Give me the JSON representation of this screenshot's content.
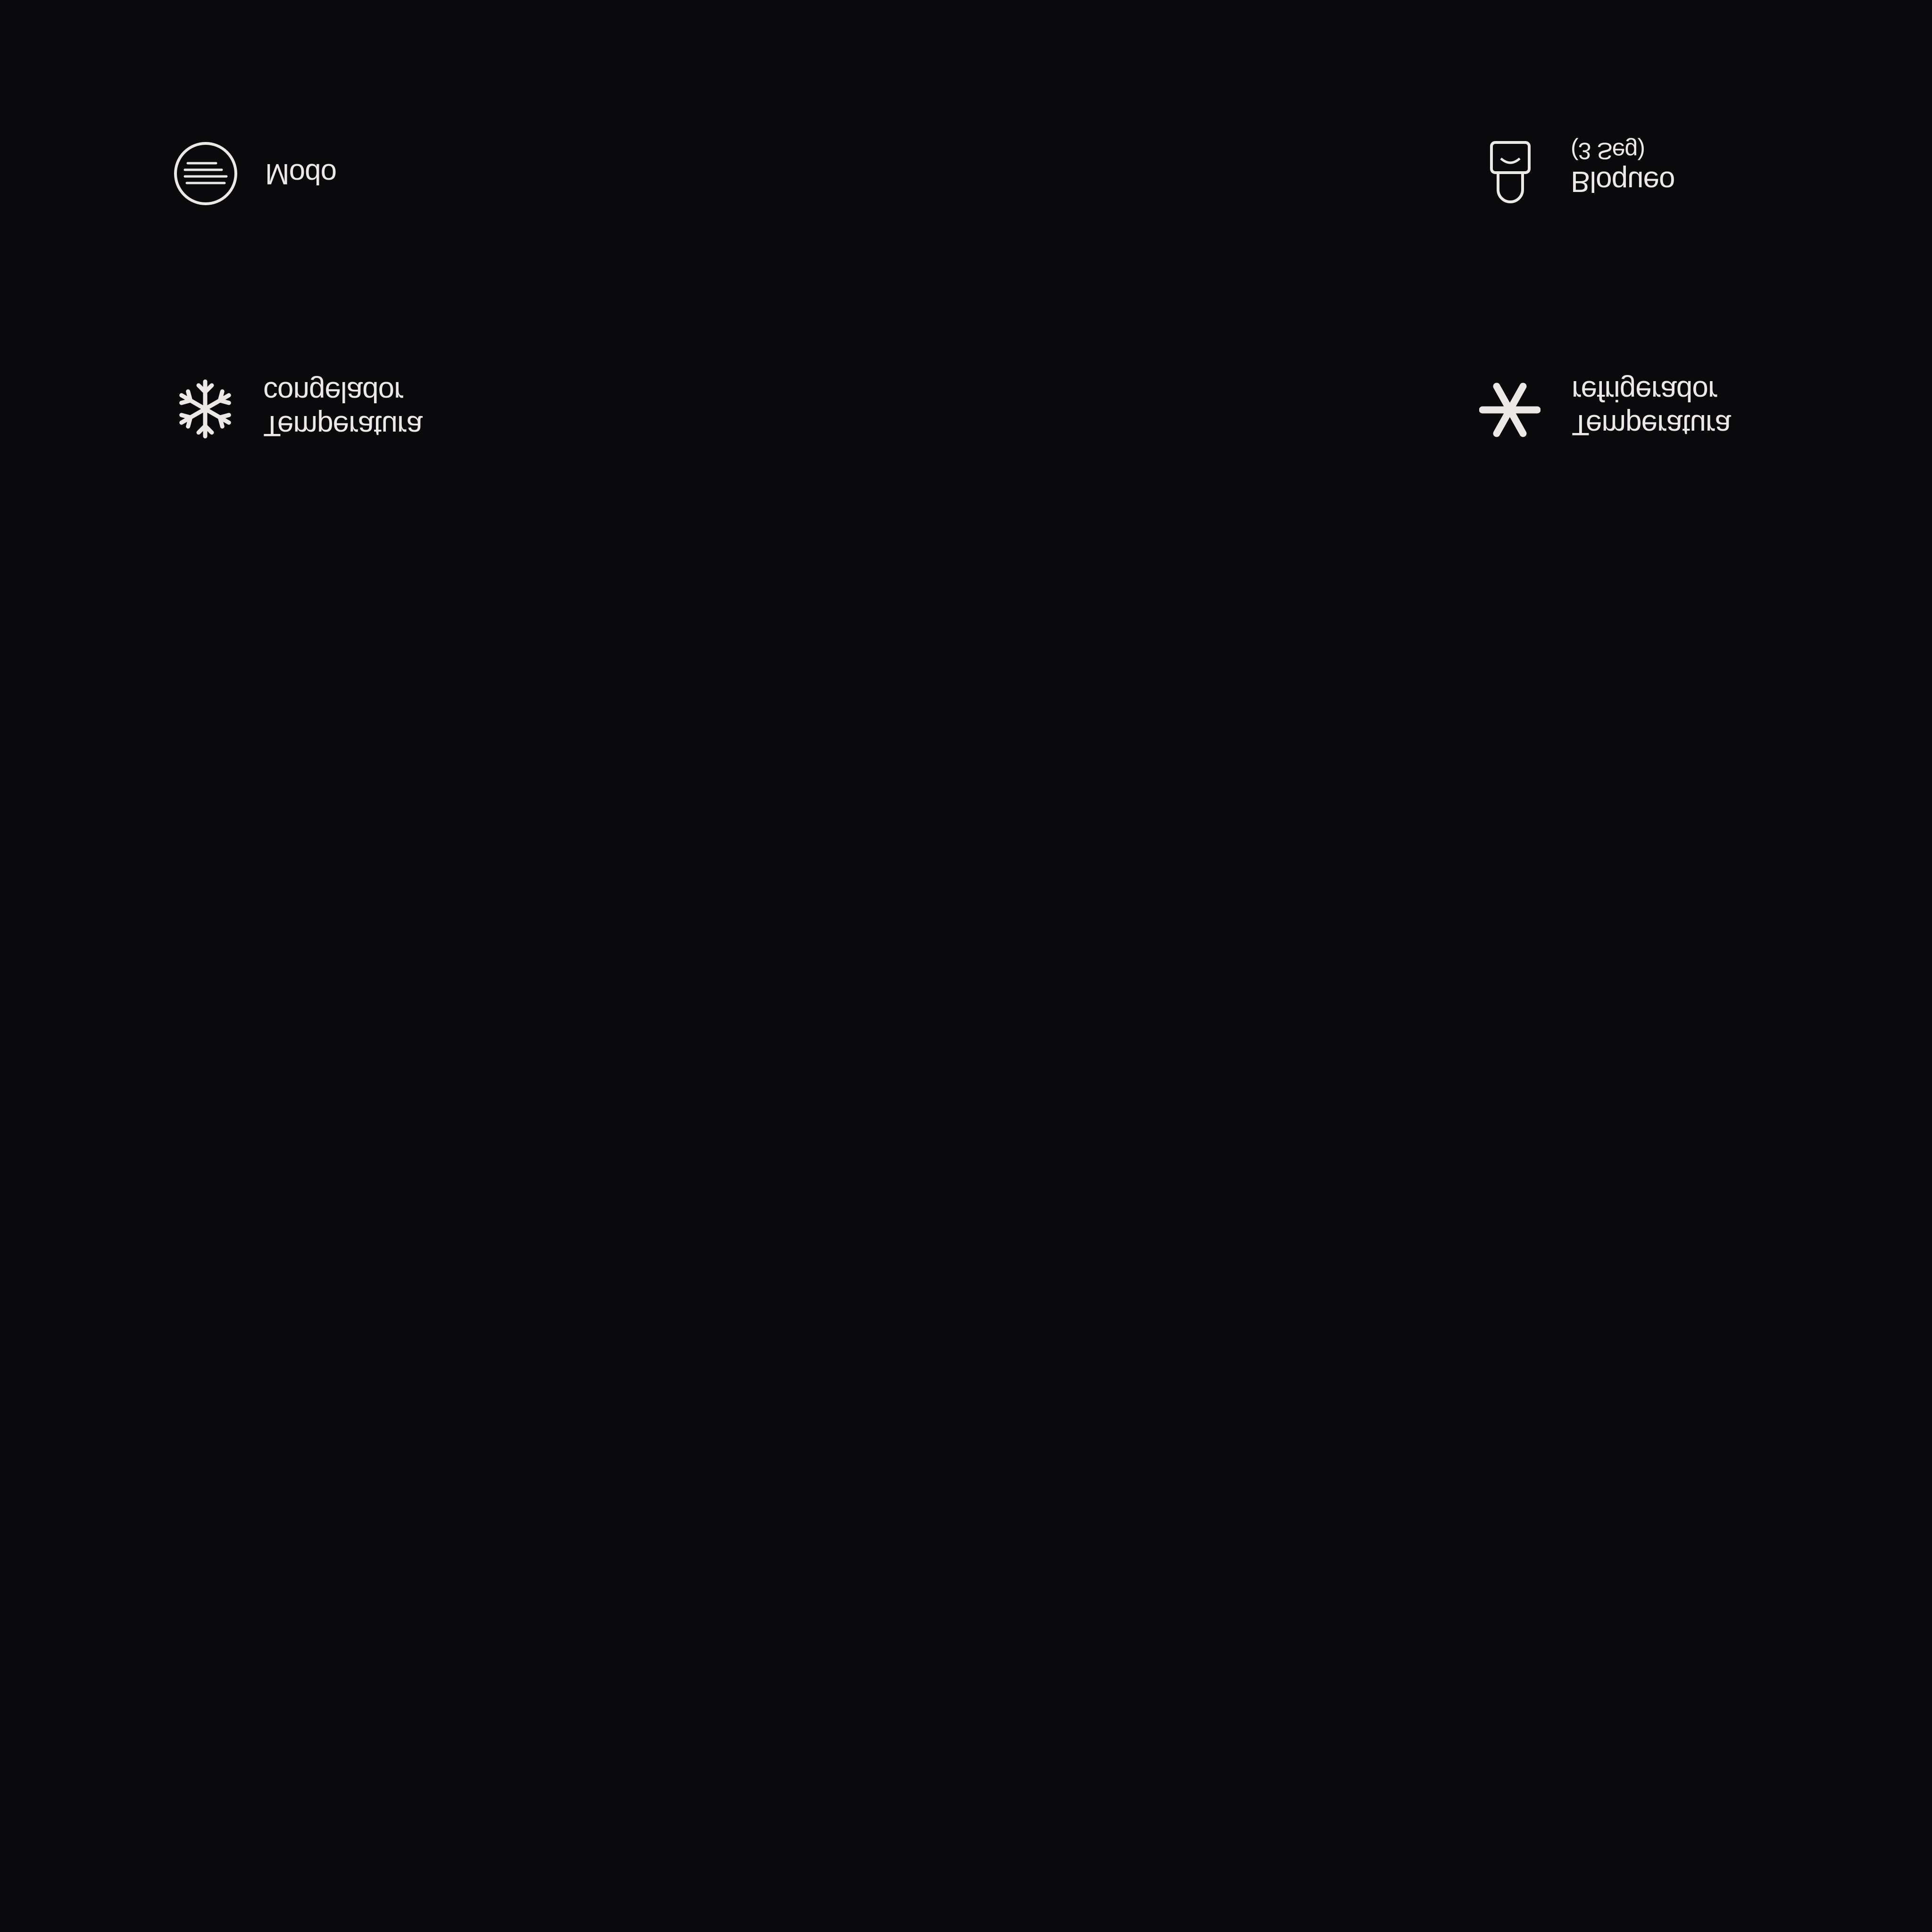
{
  "panel": {
    "background": "#0a090b",
    "foreground": "#ece8e6",
    "mirrored": "vertical",
    "buttons": [
      {
        "id": "mode",
        "icon": "menu-lines-circle-icon",
        "lines": [
          "Modo"
        ]
      },
      {
        "id": "lock",
        "icon": "lock-icon",
        "lines": [
          "Bloqueo",
          "(3 Seg)"
        ]
      },
      {
        "id": "freezer",
        "icon": "snowflake-icon",
        "lines": [
          "Temperatura",
          "congelador"
        ]
      },
      {
        "id": "fridge",
        "icon": "asterisk-icon",
        "lines": [
          "Temperatura",
          "refrigerador"
        ]
      }
    ]
  }
}
